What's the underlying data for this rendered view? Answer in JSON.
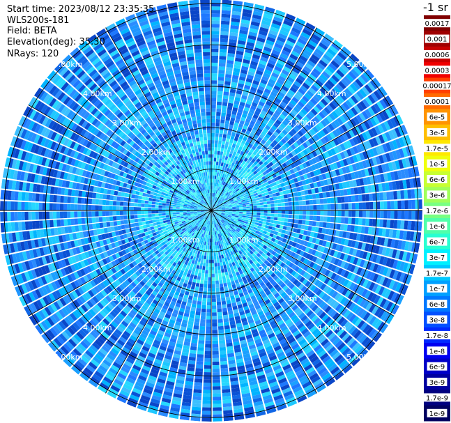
{
  "info": {
    "start_time": "Start time: 2023/08/12 23:35:35",
    "instrument": "WLS200s-181",
    "field": "Field: BETA",
    "elevation": "Elevation(deg): 35.30",
    "nrays": "NRays: 120"
  },
  "colorbar": {
    "unit_label": "-1 sr",
    "ticks": [
      "0.0017",
      "0.001",
      "0.0006",
      "0.0003",
      "0.00017",
      "0.0001",
      "6e-5",
      "3e-5",
      "1.7e-5",
      "1e-5",
      "6e-6",
      "3e-6",
      "1.7e-6",
      "1e-6",
      "6e-7",
      "3e-7",
      "1.7e-7",
      "1e-7",
      "6e-8",
      "3e-8",
      "1.7e-8",
      "1e-8",
      "6e-9",
      "3e-9",
      "1.7e-9",
      "1e-9"
    ],
    "colors": [
      "#800000",
      "#a00000",
      "#c80000",
      "#f00000",
      "#ff4000",
      "#ff6a00",
      "#ff9400",
      "#ffbe00",
      "#ffe800",
      "#f0ff0c",
      "#c8ff32",
      "#a0ff5a",
      "#78ff82",
      "#50ffaa",
      "#28ffd2",
      "#00f0ff",
      "#00c8ff",
      "#00a0ff",
      "#0078ff",
      "#0050ff",
      "#0028ff",
      "#0000f0",
      "#0000c8",
      "#0000a0",
      "#000080",
      "#000060"
    ]
  },
  "chart_data": {
    "type": "heatmap",
    "projection": "polar (PPI scan)",
    "field": "BETA",
    "unit": "sr^-1",
    "color_scale": "log",
    "range_rings_km": [
      1.0,
      2.0,
      3.0,
      4.0,
      5.0
    ],
    "ring_labels": [
      "1.00km",
      "2.00km",
      "3.00km",
      "4.00km",
      "5.00km"
    ],
    "max_range_km": 5.1,
    "spokes_deg": [
      0,
      30,
      60,
      90,
      120,
      150,
      180,
      210,
      240,
      270,
      300,
      330
    ],
    "nrays": 120,
    "dominant_value_range": [
      1e-08,
      1.7e-07
    ],
    "value_min": 1e-09,
    "value_max": 0.0017
  }
}
